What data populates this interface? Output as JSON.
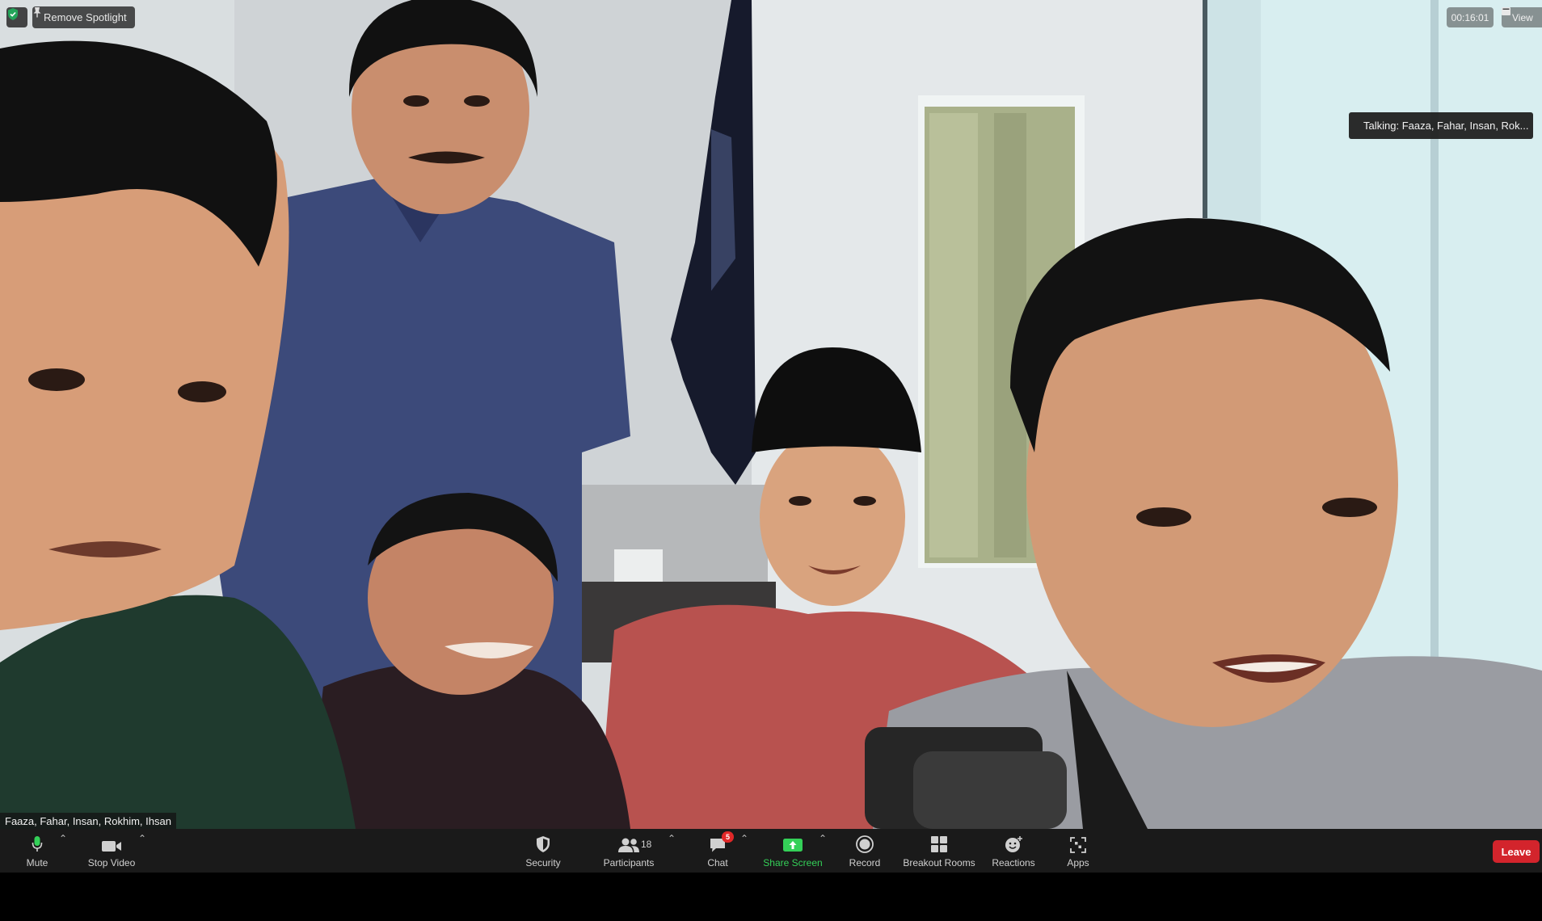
{
  "meeting": {
    "remove_spotlight": "Remove Spotlight",
    "timer": "00:16:01",
    "view_label": "View",
    "talking": "Talking: Faaza, Fahar, Insan, Rok...",
    "name_tag": "Faaza, Fahar, Insan, Rokhim, Ihsan"
  },
  "toolbar": {
    "mute": "Mute",
    "stop_video": "Stop Video",
    "security": "Security",
    "participants": "Participants",
    "participants_count": "18",
    "chat": "Chat",
    "chat_badge": "5",
    "share_screen": "Share Screen",
    "record": "Record",
    "breakout_rooms": "Breakout Rooms",
    "reactions": "Reactions",
    "apps": "Apps",
    "leave": "Leave"
  },
  "colors": {
    "toolbar_bg": "#1a1a1a",
    "share_green": "#34d058",
    "leave_red": "#d3242c",
    "security_green": "#23a55a"
  },
  "icons": [
    "shield-icon",
    "spotlight-pin-icon",
    "view-grid-icon",
    "microphone-icon",
    "video-camera-icon",
    "security-shield-icon",
    "participants-icon",
    "chat-bubble-icon",
    "share-screen-icon",
    "record-icon",
    "breakout-rooms-icon",
    "reactions-icon",
    "apps-icon"
  ]
}
